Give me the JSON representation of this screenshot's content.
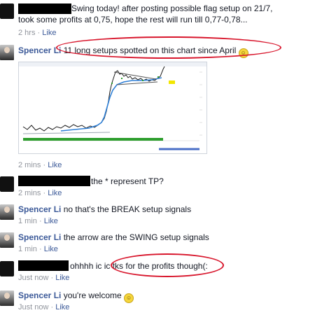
{
  "post": {
    "text_line1": "Swing today! after posting possible flag setup on 21/7,",
    "text_line2": "took some profits at 0,75, hope the rest will run till 0,77-0,78...",
    "time": "2 hrs",
    "sep": "·",
    "like": "Like"
  },
  "comments": [
    {
      "name": "Spencer Li",
      "text": "11 long setups spotted on this chart since April",
      "emoji": true,
      "time": "2 mins",
      "sep": "·",
      "like": "Like"
    },
    {
      "name": "",
      "text": "the * represent TP?",
      "emoji": false,
      "time": "2 mins",
      "sep": "·",
      "like": "Like"
    },
    {
      "name": "Spencer Li",
      "text": "no that's the BREAK setup signals",
      "emoji": false,
      "time": "1 min",
      "sep": "·",
      "like": "Like"
    },
    {
      "name": "Spencer Li",
      "text": "the arrow are the SWING setup signals",
      "emoji": false,
      "time": "1 min",
      "sep": "·",
      "like": "Like"
    },
    {
      "name": "",
      "text": "ohhhh ic ic tks for the profits though(:",
      "emoji": false,
      "time": "Just now",
      "sep": "·",
      "like": "Like"
    },
    {
      "name": "Spencer Li",
      "text": "you're welcome",
      "emoji": true,
      "time": "Just now",
      "sep": "·",
      "like": "Like"
    }
  ],
  "emoji_glyph": "☺",
  "colors": {
    "link": "#3b5998",
    "meta": "#90949c",
    "highlight": "#d8162c",
    "price": "#1a1a1a",
    "ma": "#2e7fd6",
    "volume": "#2e9e2e",
    "signal": "#f2e600"
  }
}
